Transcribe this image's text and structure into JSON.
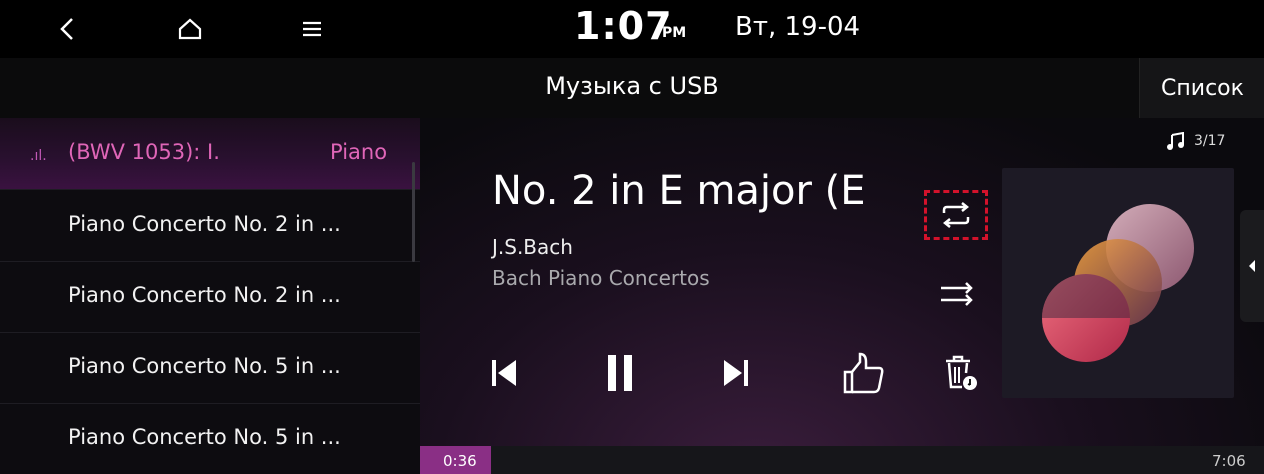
{
  "status_bar": {
    "time": "1:07",
    "ampm": "PM",
    "date": "Вт, 19-04",
    "icons": [
      "back-icon",
      "home-icon",
      "menu-icon"
    ]
  },
  "header": {
    "title": "Музыка с USB",
    "list_button": "Список"
  },
  "playlist": {
    "current": {
      "title_part": "(BWV 1053): I.",
      "title_suffix": "Piano"
    },
    "items": [
      {
        "label": "Piano Concerto No. 2 in ..."
      },
      {
        "label": "Piano Concerto No. 2 in ..."
      },
      {
        "label": "Piano Concerto No. 5 in ..."
      },
      {
        "label": "Piano Concerto No. 5 in ..."
      }
    ]
  },
  "now_playing": {
    "track_counter": "3/17",
    "title": "No. 2 in E major (E",
    "artist": "J.S.Bach",
    "album": "Bach Piano Concertos"
  },
  "controls": {
    "icons": [
      "repeat-icon",
      "shuffle-icon",
      "previous-icon",
      "pause-icon",
      "next-icon",
      "like-icon",
      "delete-icon"
    ]
  },
  "progress": {
    "elapsed": "0:36",
    "total": "7:06",
    "fraction": 0.0845
  },
  "colors": {
    "accent": "#e066b8",
    "highlight": "#d3122b",
    "progress": "#8a2f85"
  }
}
